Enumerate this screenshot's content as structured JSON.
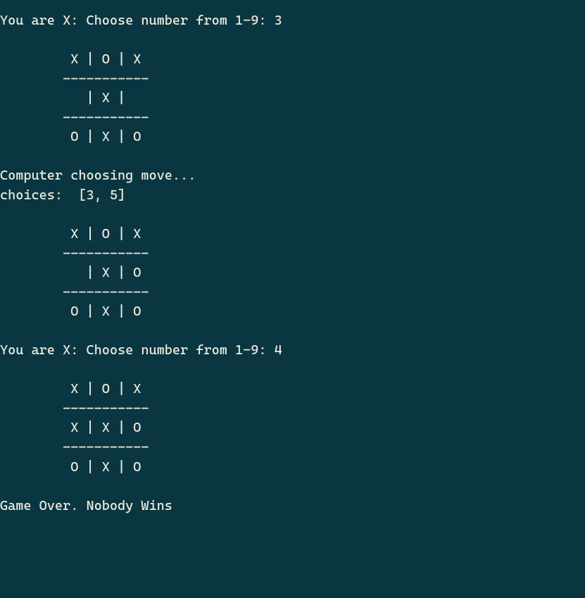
{
  "lines": [
    "You are X: Choose number from 1-9: 3",
    "",
    "         X | O | X",
    "        -----------",
    "           | X |  ",
    "        -----------",
    "         O | X | O",
    "",
    "Computer choosing move...",
    "choices:  [3, 5]",
    "",
    "         X | O | X",
    "        -----------",
    "           | X | O",
    "        -----------",
    "         O | X | O",
    "",
    "You are X: Choose number from 1-9: 4",
    "",
    "         X | O | X",
    "        -----------",
    "         X | X | O",
    "        -----------",
    "         O | X | O",
    "",
    "Game Over. Nobody Wins"
  ],
  "game": {
    "player_symbol": "X",
    "prompts": [
      {
        "text": "You are X: Choose number from 1-9:",
        "input": 3
      },
      {
        "text": "You are X: Choose number from 1-9:",
        "input": 4
      }
    ],
    "computer_turn_message": "Computer choosing move...",
    "computer_choices_label": "choices:",
    "computer_choices": [
      3,
      5
    ],
    "boards": [
      [
        [
          "X",
          "O",
          "X"
        ],
        [
          " ",
          "X",
          " "
        ],
        [
          "O",
          "X",
          "O"
        ]
      ],
      [
        [
          "X",
          "O",
          "X"
        ],
        [
          " ",
          "X",
          "O"
        ],
        [
          "O",
          "X",
          "O"
        ]
      ],
      [
        [
          "X",
          "O",
          "X"
        ],
        [
          "X",
          "X",
          "O"
        ],
        [
          "O",
          "X",
          "O"
        ]
      ]
    ],
    "game_over_message": "Game Over. Nobody Wins"
  }
}
